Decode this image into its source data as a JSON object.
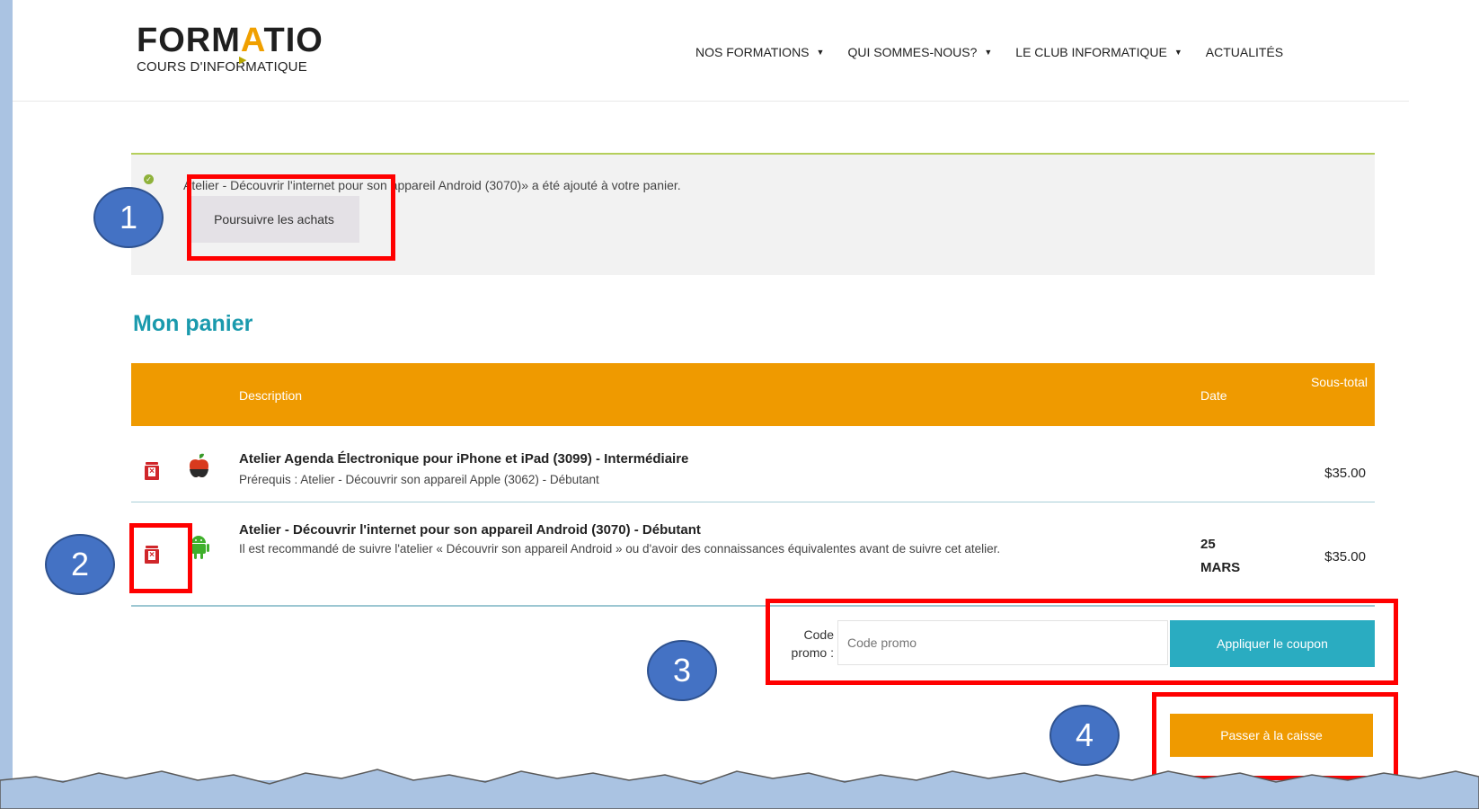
{
  "header": {
    "logo_main_left": "FORM",
    "logo_main_a": "A",
    "logo_main_right": "TIO",
    "logo_sub": "COURS D'INFORMATIQUE",
    "nav": [
      {
        "label": "NOS FORMATIONS"
      },
      {
        "label": "QUI SOMMES-NOUS?"
      },
      {
        "label": "LE CLUB INFORMATIQUE"
      },
      {
        "label": "ACTUALITÉS"
      }
    ]
  },
  "notice": {
    "message": "Atelier - Découvrir l'internet pour son appareil Android (3070)» a été ajouté à votre panier.",
    "continue_label": "Poursuivre les achats"
  },
  "cart": {
    "title": "Mon panier",
    "columns": {
      "description": "Description",
      "date": "Date",
      "subtotal": "Sous-total"
    },
    "items": [
      {
        "title": "Atelier Agenda Électronique pour iPhone et iPad (3099) - Intermédiaire",
        "note": "Prérequis : Atelier - Découvrir son appareil Apple (3062) - Débutant",
        "date": "",
        "price": "$35.00",
        "icon": "apple-icon"
      },
      {
        "title": "Atelier - Découvrir l'internet pour son appareil Android (3070) - Débutant",
        "note": "Il est recommandé de suivre l'atelier « Découvrir son appareil Android » ou d'avoir des connaissances équivalentes avant de suivre cet atelier.",
        "date_day": "25",
        "date_month": "MARS",
        "price": "$35.00",
        "icon": "android-icon"
      }
    ]
  },
  "coupon": {
    "label": "Code promo :",
    "placeholder": "Code promo",
    "apply_label": "Appliquer le coupon"
  },
  "checkout": {
    "label": "Passer à la caisse"
  },
  "annotations": [
    "1",
    "2",
    "3",
    "4"
  ],
  "colors": {
    "accent_orange": "#ef9a00",
    "accent_teal": "#2aacc1",
    "title_teal": "#1a9aad",
    "highlight_red": "#ff0000",
    "badge_blue": "#4472c4"
  }
}
